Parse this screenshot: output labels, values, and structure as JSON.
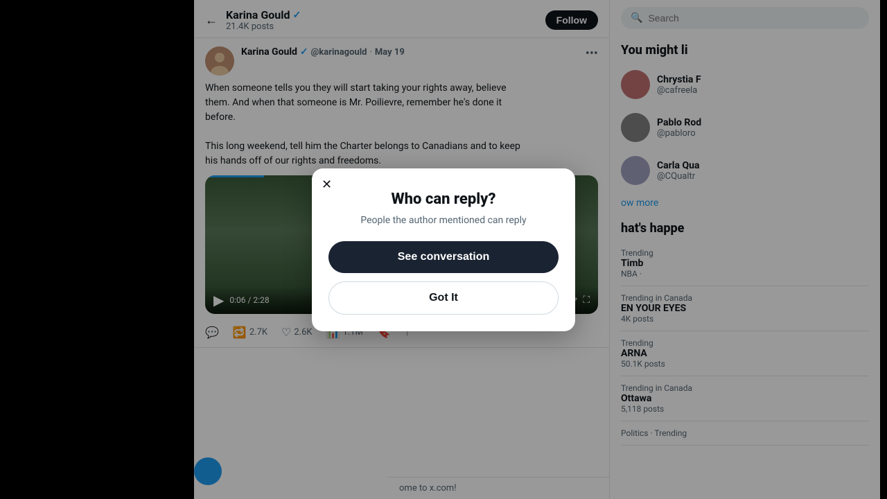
{
  "layout": {
    "left_bar_width": 280,
    "right_bar_width": 10
  },
  "header": {
    "back_label": "←",
    "profile_name": "Karina Gould",
    "verified": true,
    "post_count": "21.4K posts",
    "follow_label": "Follow"
  },
  "tweet": {
    "author_name": "Karina Gould",
    "author_handle": "@karinagould",
    "date": "May 19",
    "more_icon": "•••",
    "text_line1": "When someone tells you they will start taking your rights away, believe",
    "text_line2": "them. And when that someone is Mr. Poilievre, remember he's done it",
    "text_line3": "before.",
    "text_line4": "This long weekend, tell him the Charter belongs to Canadians and to keep",
    "text_line5": "his hands off of our rights and freedoms.",
    "video_time": "0:06 / 2:28",
    "retweet_count": "2.7K",
    "like_count": "2.6K",
    "view_count": "1.1M"
  },
  "sidebar": {
    "search_placeholder": "Search",
    "might_like_title": "You might li",
    "suggest_users": [
      {
        "name": "Chrystia F",
        "handle": "@cafreela"
      },
      {
        "name": "Pablo Rod",
        "handle": "@pabloro"
      },
      {
        "name": "Carla Qua",
        "handle": "@CQualtr"
      }
    ],
    "show_more_label": "ow more",
    "whats_happening_title": "hat's happe",
    "trends": [
      {
        "category": "Trending",
        "name": "Timb",
        "context": "NBA ·"
      },
      {
        "category": "Trending in Canada",
        "name": "EN YOUR EYES",
        "posts": "4K posts"
      },
      {
        "category": "Trending",
        "name": "ARNA",
        "posts": "50.1K posts"
      },
      {
        "category": "Trending in Canada",
        "name": "Ottawa",
        "posts": "5,118 posts"
      },
      {
        "category": "Politics · Trending",
        "name": ""
      }
    ]
  },
  "modal": {
    "close_icon": "✕",
    "title": "Who can reply?",
    "subtitle": "People the author mentioned can reply",
    "see_conversation_label": "See conversation",
    "got_it_label": "Got It"
  },
  "bottom": {
    "welcome_text": "ome to x.com!"
  }
}
